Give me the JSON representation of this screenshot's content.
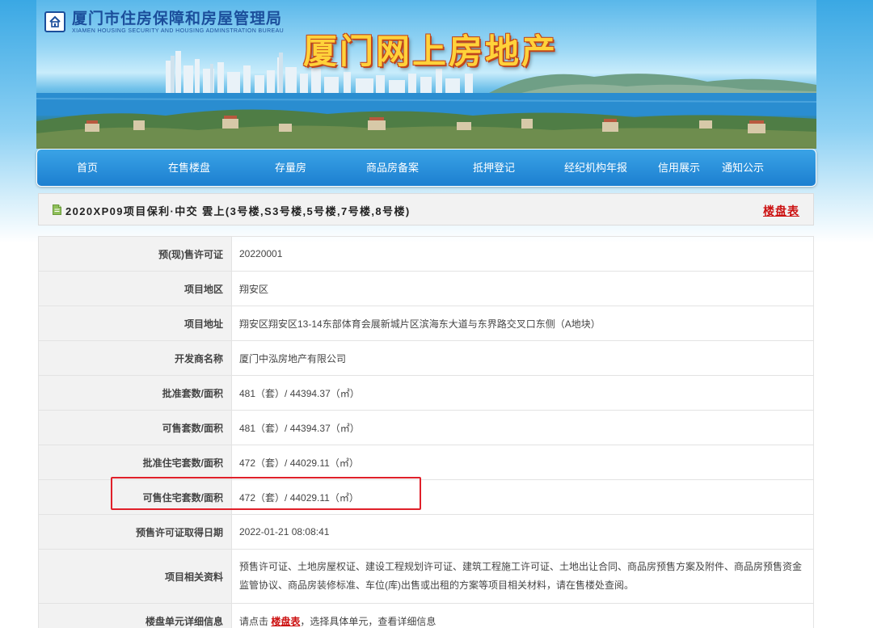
{
  "header": {
    "bureau_name": "厦门市住房保障和房屋管理局",
    "bureau_name_en": "XIAMEN HOUSING SECURITY AND HOUSING ADMINSTRATION BUREAU",
    "site_title": "厦门网上房地产"
  },
  "nav": {
    "items": [
      {
        "label": "首页"
      },
      {
        "label": "在售楼盘"
      },
      {
        "label": "存量房"
      },
      {
        "label": "商品房备案"
      },
      {
        "label": "抵押登记"
      },
      {
        "label": "经纪机构年报"
      },
      {
        "label": "信用展示"
      },
      {
        "label": "通知公示"
      }
    ]
  },
  "project": {
    "title": "2020XP09项目保利·中交 雲上(3号楼,S3号楼,5号楼,7号楼,8号楼)",
    "table_link": "楼盘表"
  },
  "info": {
    "rows": [
      {
        "label": "预(现)售许可证",
        "value": "20220001"
      },
      {
        "label": "项目地区",
        "value": "翔安区"
      },
      {
        "label": "项目地址",
        "value": "翔安区翔安区13-14东部体育会展新城片区滨海东大道与东界路交叉口东侧（A地块）"
      },
      {
        "label": "开发商名称",
        "value": "厦门中泓房地产有限公司"
      },
      {
        "label": "批准套数/面积",
        "value": "481（套）/ 44394.37（㎡）"
      },
      {
        "label": "可售套数/面积",
        "value": "481（套）/ 44394.37（㎡）"
      },
      {
        "label": "批准住宅套数/面积",
        "value": "472（套）/ 44029.11（㎡）"
      },
      {
        "label": "可售住宅套数/面积",
        "value": "472（套）/ 44029.11（㎡）"
      },
      {
        "label": "预售许可证取得日期",
        "value": "2022-01-21 08:08:41"
      },
      {
        "label": "项目相关资料",
        "value": "预售许可证、土地房屋权证、建设工程规划许可证、建筑工程施工许可证、土地出让合同、商品房预售方案及附件、商品房预售资金监管协议、商品房装修标准、车位(库)出售或出租的方案等项目相关材料，请在售楼处查阅。"
      }
    ],
    "detail_row": {
      "label": "楼盘单元详细信息",
      "prefix": "请点击",
      "link": "楼盘表",
      "suffix": "，选择具体单元，查看详细信息"
    }
  }
}
